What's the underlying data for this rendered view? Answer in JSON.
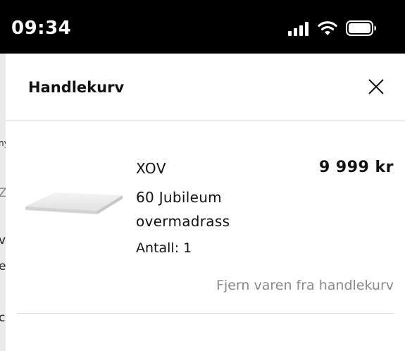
{
  "status_bar": {
    "time": "09:34",
    "icons": [
      "cellular-signal-icon",
      "wifi-icon",
      "battery-icon"
    ]
  },
  "background_fragments": [
    "ny",
    "Z",
    "v",
    "e",
    "c"
  ],
  "cart": {
    "title": "Handlekurv",
    "close_icon": "close-icon",
    "items": [
      {
        "brand": "XOV",
        "name": "60 Jubileum overmadrass",
        "price": "9 999 kr",
        "quantity_label": "Antall: 1",
        "remove_label": "Fjern varen fra handlekurv",
        "image": "mattress-topper-image"
      }
    ]
  }
}
